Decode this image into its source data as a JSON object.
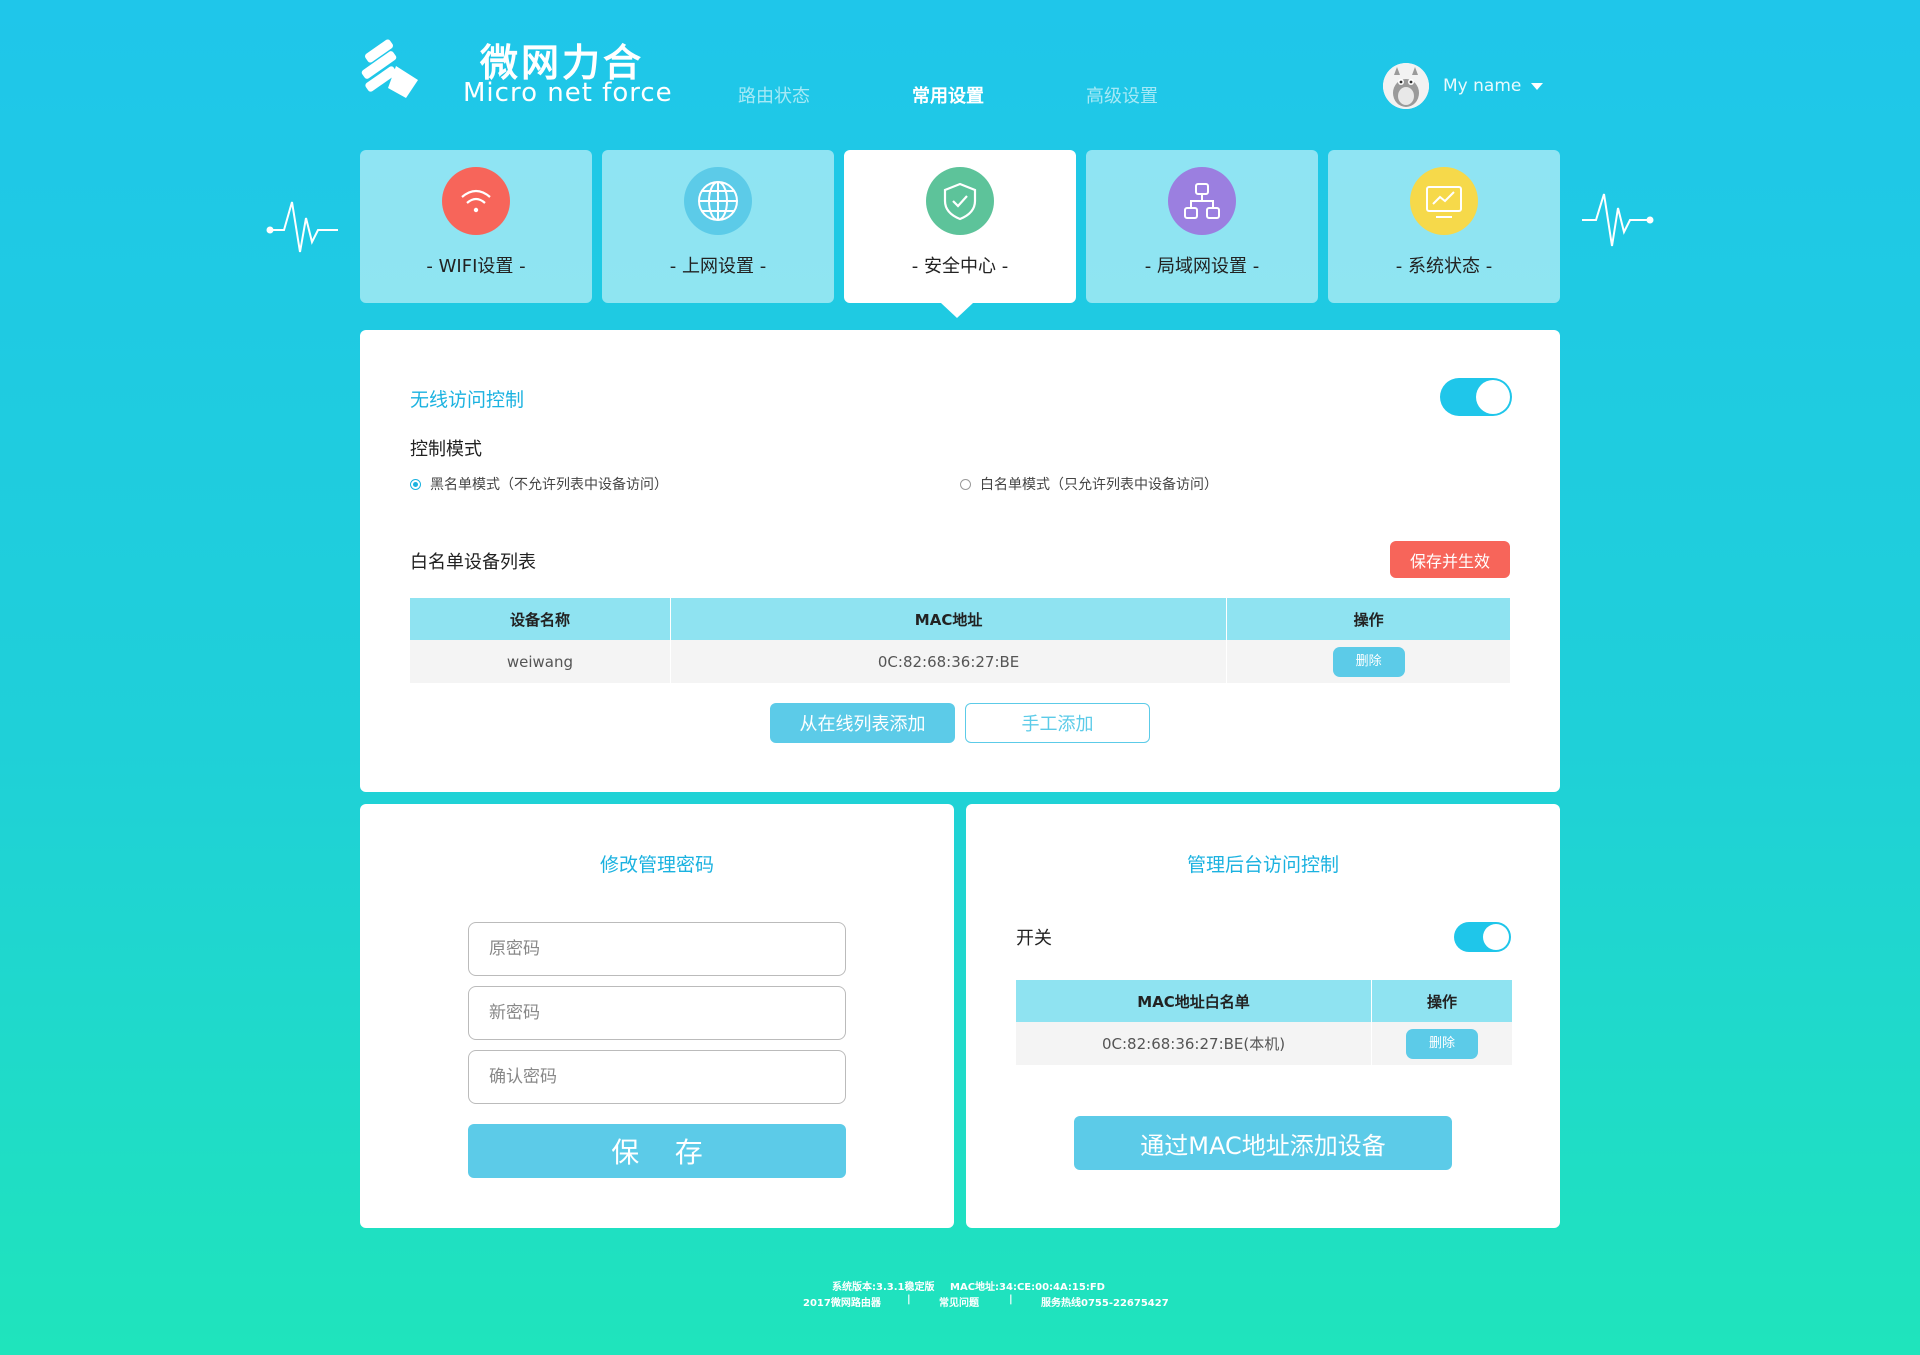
{
  "brand": {
    "name_cn": "微网力合",
    "name_en": "Micro net force"
  },
  "nav": [
    {
      "label": "路由状态",
      "active": false
    },
    {
      "label": "常用设置",
      "active": true
    },
    {
      "label": "高级设置",
      "active": false
    }
  ],
  "user": {
    "name": "My name"
  },
  "tabs": [
    {
      "label": "-  WIFI设置  -",
      "icon": "wifi-icon",
      "color": "#f7655a"
    },
    {
      "label": "-  上网设置  -",
      "icon": "globe-icon",
      "color": "#5ccbe8"
    },
    {
      "label": "-  安全中心  -",
      "icon": "shield-icon",
      "color": "#5dc39a"
    },
    {
      "label": "-  局域网设置  -",
      "icon": "network-icon",
      "color": "#9b7fe0"
    },
    {
      "label": "-  系统状态  -",
      "icon": "monitor-icon",
      "color": "#f6d94a"
    }
  ],
  "wireless": {
    "title": "无线访问控制",
    "mode_label": "控制模式",
    "blacklist": "黑名单模式（不允许列表中设备访问）",
    "whitelist": "白名单模式（只允许列表中设备访问）",
    "list_title": "白名单设备列表",
    "save_btn": "保存并生效",
    "columns": [
      "设备名称",
      "MAC地址",
      "操作"
    ],
    "rows": [
      {
        "name": "weiwang",
        "mac": "0C:82:68:36:27:BE",
        "action": "删除"
      }
    ],
    "add_online": "从在线列表添加",
    "add_manual": "手工添加"
  },
  "password": {
    "title": "修改管理密码",
    "old_placeholder": "原密码",
    "new_placeholder": "新密码",
    "confirm_placeholder": "确认密码",
    "save_btn": "保    存"
  },
  "admin": {
    "title": "管理后台访问控制",
    "switch_label": "开关",
    "columns": [
      "MAC地址白名单",
      "操作"
    ],
    "rows": [
      {
        "mac": "0C:82:68:36:27:BE(本机)",
        "action": "删除"
      }
    ],
    "add_btn": "通过MAC地址添加设备"
  },
  "footer": {
    "version": "系统版本:3.3.1稳定版",
    "mac": "MAC地址:34:CE:00:4A:15:FD",
    "copyright": "2017微网路由器",
    "sep": "|",
    "faq": "常见问题",
    "hotline": "服务热线0755-22675427"
  },
  "colors": {
    "accent": "#1fc6ea",
    "button": "#5ccbe8",
    "danger": "#f7655a",
    "header_row": "#8fe3f1"
  }
}
